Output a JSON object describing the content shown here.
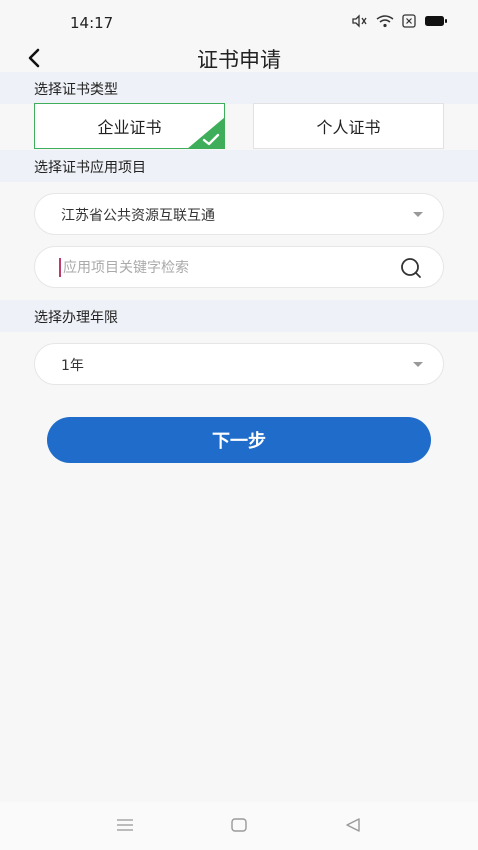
{
  "status_bar": {
    "time": "14:17"
  },
  "header": {
    "title": "证书申请"
  },
  "sections": {
    "cert_type_label": "选择证书类型",
    "project_label": "选择证书应用项目",
    "years_label": "选择办理年限"
  },
  "cert_types": [
    {
      "label": "企业证书",
      "selected": true
    },
    {
      "label": "个人证书",
      "selected": false
    }
  ],
  "project": {
    "selected_value": "江苏省公共资源互联互通",
    "search_placeholder": "应用项目关键字检索",
    "search_value": ""
  },
  "years": {
    "selected_value": "1年"
  },
  "actions": {
    "next_label": "下一步"
  },
  "colors": {
    "accent_blue": "#1f6cca",
    "selected_green": "#3fae5a",
    "section_bg": "#eef1f7"
  }
}
